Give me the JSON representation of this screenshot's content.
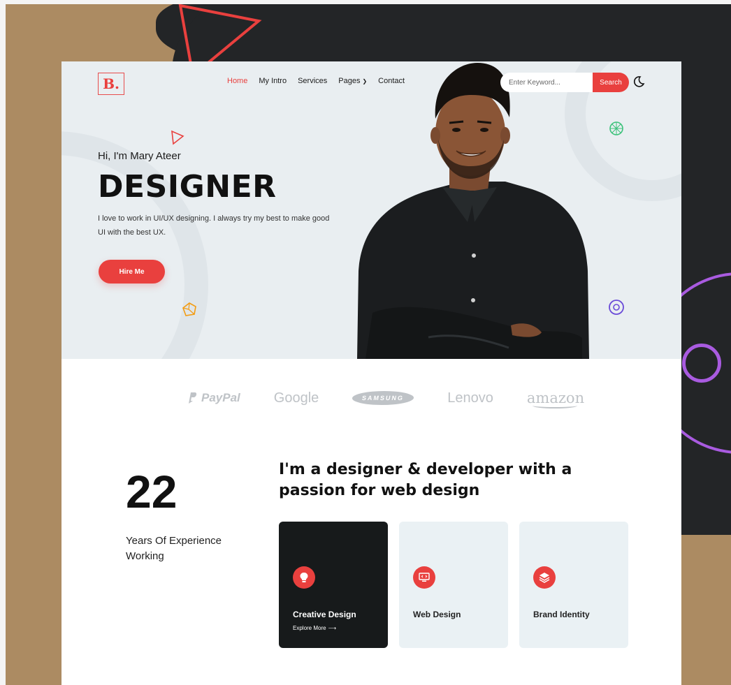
{
  "brand": {
    "logo_text": "B.",
    "accent": "#e9403e"
  },
  "nav": {
    "items": [
      {
        "label": "Home",
        "active": true
      },
      {
        "label": "My Intro",
        "active": false
      },
      {
        "label": "Services",
        "active": false
      },
      {
        "label": "Pages",
        "active": false,
        "has_dropdown": true
      },
      {
        "label": "Contact",
        "active": false
      }
    ]
  },
  "search": {
    "placeholder": "Enter Keyword...",
    "button_label": "Search"
  },
  "theme_toggle_icon": "moon-icon",
  "hero": {
    "greeting": "Hi, I'm Mary Ateer",
    "title": "DESIGNER",
    "description": "I love to work in UI/UX designing. I always try my best to make good UI with the best UX.",
    "cta_label": "Hire Me"
  },
  "brands": [
    {
      "name": "PayPal",
      "icon": "paypal-logo"
    },
    {
      "name": "Google"
    },
    {
      "name": "SAMSUNG"
    },
    {
      "name": "Lenovo"
    },
    {
      "name": "amazon"
    }
  ],
  "stats": {
    "years": "22",
    "years_label": "Years Of Experience Working"
  },
  "about": {
    "heading": "I'm a designer & developer with a passion for web design"
  },
  "services": [
    {
      "label": "Creative Design",
      "icon": "lightbulb-icon",
      "link": "Explore More",
      "highlighted": true
    },
    {
      "label": "Web Design",
      "icon": "monitor-code-icon",
      "highlighted": false
    },
    {
      "label": "Brand Identity",
      "icon": "layers-icon",
      "highlighted": false
    }
  ]
}
